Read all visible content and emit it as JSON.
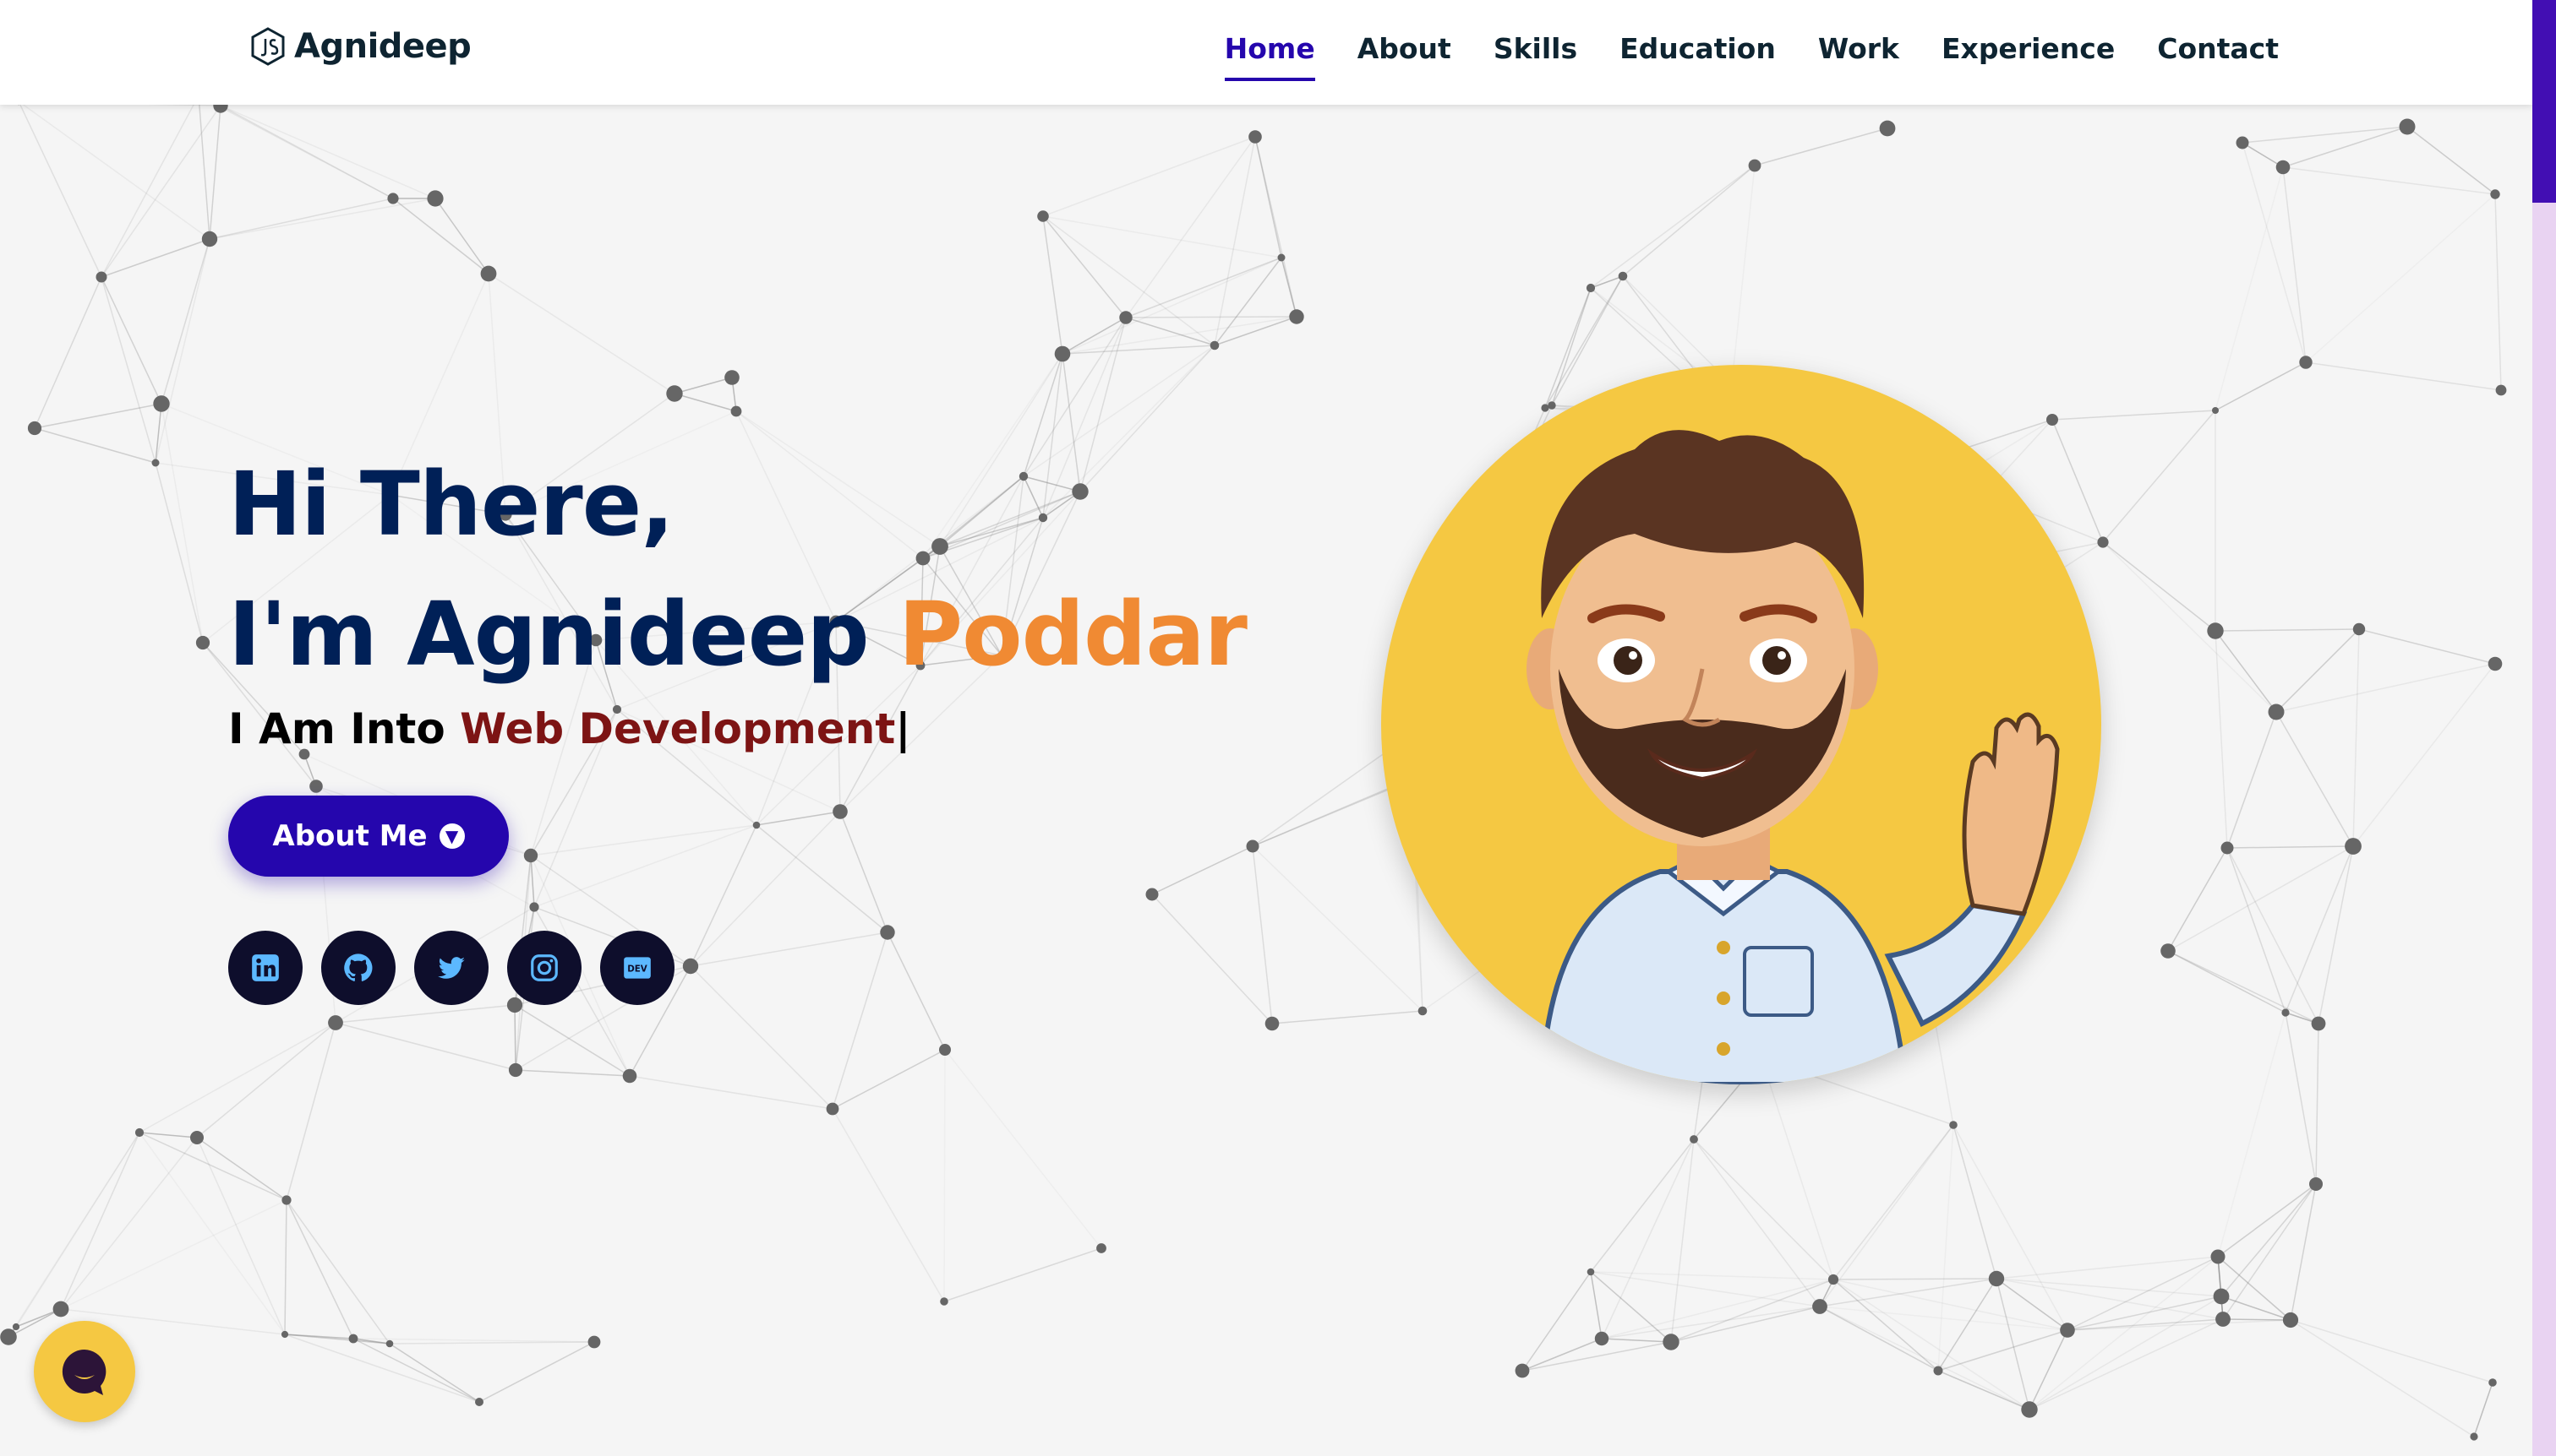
{
  "header": {
    "logo_text": "Agnideep",
    "logo_icon": "js-hexagon-icon",
    "nav": [
      {
        "label": "Home",
        "active": true
      },
      {
        "label": "About"
      },
      {
        "label": "Skills"
      },
      {
        "label": "Education"
      },
      {
        "label": "Work"
      },
      {
        "label": "Experience"
      },
      {
        "label": "Contact"
      }
    ]
  },
  "hero": {
    "greeting": "Hi There,",
    "intro_prefix": "I'm Agnideep ",
    "intro_highlight": "Poddar",
    "typed_prefix": "I Am Into ",
    "typed_role": "Web Development",
    "typed_cursor": "|",
    "about_button": "About Me",
    "socials": [
      "linkedin-icon",
      "github-icon",
      "twitter-icon",
      "instagram-icon",
      "dev-icon"
    ]
  },
  "chat_widget": {
    "icon": "chat-icon"
  },
  "colors": {
    "accent": "#2506ad",
    "name_highlight": "#f08a33",
    "role_highlight": "#7d1414",
    "heading": "#002057",
    "avatar_bg": "#f5c842"
  }
}
